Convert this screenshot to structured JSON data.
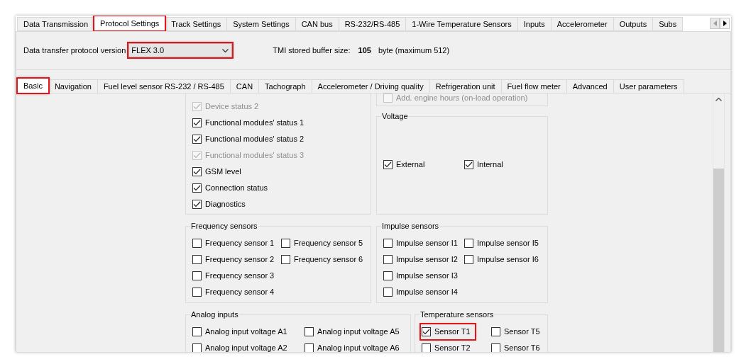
{
  "top_tabs": [
    {
      "label": "Data Transmission",
      "selected": false,
      "highlighted": false
    },
    {
      "label": "Protocol Settings",
      "selected": true,
      "highlighted": true
    },
    {
      "label": "Track Settings",
      "selected": false,
      "highlighted": false
    },
    {
      "label": "System Settings",
      "selected": false,
      "highlighted": false
    },
    {
      "label": "CAN bus",
      "selected": false,
      "highlighted": false
    },
    {
      "label": "RS-232/RS-485",
      "selected": false,
      "highlighted": false
    },
    {
      "label": "1-Wire Temperature Sensors",
      "selected": false,
      "highlighted": false
    },
    {
      "label": "Inputs",
      "selected": false,
      "highlighted": false
    },
    {
      "label": "Accelerometer",
      "selected": false,
      "highlighted": false
    },
    {
      "label": "Outputs",
      "selected": false,
      "highlighted": false
    },
    {
      "label": "Subs",
      "selected": false,
      "highlighted": false
    }
  ],
  "protocol_version": {
    "label": "Data transfer protocol version",
    "value": "FLEX 3.0",
    "highlighted": true
  },
  "buffer_size": {
    "label": "TMI stored buffer size:",
    "value": "105",
    "unit": "byte (maximum 512)"
  },
  "sub_tabs": [
    {
      "label": "Basic",
      "selected": true,
      "highlighted": true
    },
    {
      "label": "Navigation",
      "selected": false,
      "highlighted": false
    },
    {
      "label": "Fuel level sensor RS-232 / RS-485",
      "selected": false,
      "highlighted": false
    },
    {
      "label": "CAN",
      "selected": false,
      "highlighted": false
    },
    {
      "label": "Tachograph",
      "selected": false,
      "highlighted": false
    },
    {
      "label": "Accelerometer / Driving quality",
      "selected": false,
      "highlighted": false
    },
    {
      "label": "Refrigeration unit",
      "selected": false,
      "highlighted": false
    },
    {
      "label": "Fuel flow meter",
      "selected": false,
      "highlighted": false
    },
    {
      "label": "Advanced",
      "selected": false,
      "highlighted": false
    },
    {
      "label": "User parameters",
      "selected": false,
      "highlighted": false
    }
  ],
  "groups": [
    {
      "columns": [
        [
          {
            "label": "Device status 2",
            "checked": true,
            "disabled": true
          },
          {
            "label": "Functional modules' status 1",
            "checked": true,
            "disabled": false
          },
          {
            "label": "Functional modules' status 2",
            "checked": true,
            "disabled": false
          },
          {
            "label": "Functional modules' status 3",
            "checked": true,
            "disabled": true
          },
          {
            "label": "GSM level",
            "checked": true,
            "disabled": false
          },
          {
            "label": "Connection status",
            "checked": true,
            "disabled": false
          },
          {
            "label": "Diagnostics",
            "checked": true,
            "disabled": false
          }
        ]
      ]
    },
    {
      "columns": [
        [
          {
            "label": "Add. engine hours (on-load operation)",
            "checked": false,
            "disabled": true
          }
        ]
      ]
    },
    {
      "title": "Voltage",
      "columns": [
        [
          {
            "label": "External",
            "checked": true,
            "disabled": false
          }
        ],
        [
          {
            "label": "Internal",
            "checked": true,
            "disabled": false
          }
        ]
      ]
    },
    {
      "title": "Frequency sensors",
      "columns": [
        [
          {
            "label": "Frequency sensor 1",
            "checked": false,
            "disabled": false
          },
          {
            "label": "Frequency sensor 2",
            "checked": false,
            "disabled": false
          },
          {
            "label": "Frequency sensor 3",
            "checked": false,
            "disabled": false
          },
          {
            "label": "Frequency sensor 4",
            "checked": false,
            "disabled": false
          }
        ],
        [
          {
            "label": "Frequency sensor 5",
            "checked": false,
            "disabled": false
          },
          {
            "label": "Frequency sensor 6",
            "checked": false,
            "disabled": false
          }
        ]
      ]
    },
    {
      "title": "Impulse sensors",
      "columns": [
        [
          {
            "label": "Impulse sensor I1",
            "checked": false,
            "disabled": false
          },
          {
            "label": "Impulse sensor I2",
            "checked": false,
            "disabled": false
          },
          {
            "label": "Impulse sensor I3",
            "checked": false,
            "disabled": false
          },
          {
            "label": "Impulse sensor I4",
            "checked": false,
            "disabled": false
          }
        ],
        [
          {
            "label": "Impulse sensor I5",
            "checked": false,
            "disabled": false
          },
          {
            "label": "Impulse sensor I6",
            "checked": false,
            "disabled": false
          }
        ]
      ]
    },
    {
      "title": "Analog inputs",
      "columns": [
        [
          {
            "label": "Analog input voltage A1",
            "checked": false,
            "disabled": false
          },
          {
            "label": "Analog input voltage A2",
            "checked": false,
            "disabled": false
          }
        ],
        [
          {
            "label": "Analog input voltage A5",
            "checked": false,
            "disabled": false
          },
          {
            "label": "Analog input voltage A6",
            "checked": false,
            "disabled": false
          }
        ]
      ]
    },
    {
      "title": "Temperature sensors",
      "columns": [
        [
          {
            "label": "Sensor T1",
            "checked": true,
            "disabled": false,
            "highlighted": true
          },
          {
            "label": "Sensor T2",
            "checked": false,
            "disabled": false
          }
        ],
        [
          {
            "label": "Sensor T5",
            "checked": false,
            "disabled": false
          },
          {
            "label": "Sensor T6",
            "checked": false,
            "disabled": false
          }
        ]
      ]
    }
  ]
}
